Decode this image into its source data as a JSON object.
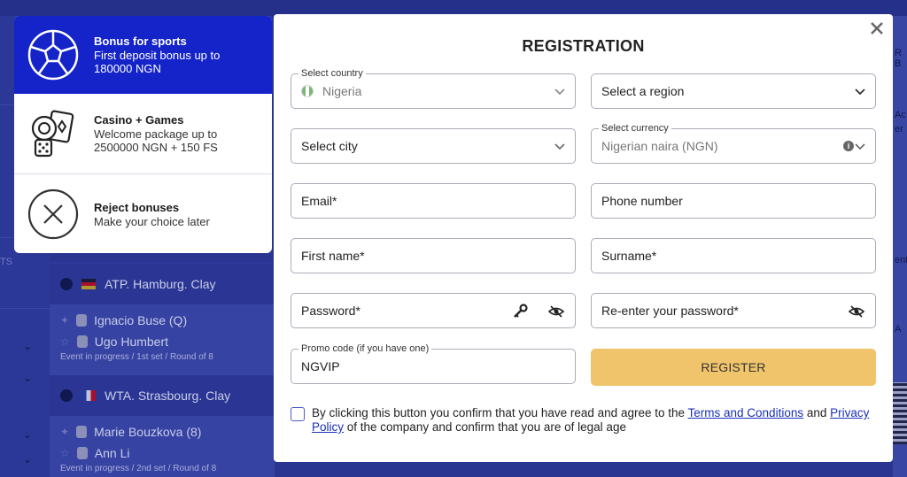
{
  "background": {
    "sports_label": "TS",
    "leagues": [
      {
        "name": "ATP. Hamburg. Clay",
        "players": [
          "Ignacio Buse (Q)",
          "Ugo Humbert"
        ],
        "meta": "Event in progress / 1st set / Round of 8"
      },
      {
        "name": "WTA. Strasbourg. Clay",
        "players": [
          "Marie Bouzkova (8)",
          "Ann Li"
        ],
        "meta": "Event in progress / 2nd set / Round of 8"
      }
    ],
    "right_fragments": [
      "R B",
      "Ac",
      "er",
      "ent",
      "A"
    ]
  },
  "bonuses": [
    {
      "icon": "soccer-ball-icon",
      "title": "Bonus for sports",
      "desc_line1": "First deposit bonus up to",
      "desc_line2": "180000 NGN",
      "active": true
    },
    {
      "icon": "casino-chips-dice-icon",
      "title": "Casino + Games",
      "desc_line1": "Welcome package up to",
      "desc_line2": "2500000 NGN + 150 FS",
      "active": false
    },
    {
      "icon": "reject-x-icon",
      "title": "Reject bonuses",
      "desc_line1": "Make your choice later",
      "desc_line2": "",
      "active": false
    }
  ],
  "modal": {
    "title": "REGISTRATION",
    "country": {
      "legend": "Select country",
      "value": "Nigeria"
    },
    "region": {
      "placeholder": "Select a region"
    },
    "city": {
      "placeholder": "Select city"
    },
    "currency": {
      "legend": "Select currency",
      "value": "Nigerian naira (NGN)"
    },
    "email": {
      "placeholder": "Email*"
    },
    "phone": {
      "placeholder": "Phone number"
    },
    "first_name": {
      "placeholder": "First name*"
    },
    "surname": {
      "placeholder": "Surname*"
    },
    "password": {
      "placeholder": "Password*"
    },
    "password_confirm": {
      "placeholder": "Re-enter your password*"
    },
    "promo": {
      "legend": "Promo code (if you have one)",
      "value": "NGVIP"
    },
    "register_label": "REGISTER",
    "agree": {
      "text_before": "By clicking this button you confirm that you have read and agree to the ",
      "terms_link": "Terms and Conditions",
      "and": " and ",
      "privacy_link": "Privacy Policy",
      "text_after": " of the company and confirm that you are of legal age"
    }
  },
  "colors": {
    "accent": "#1524c9",
    "register_button": "#f0c46b",
    "link": "#1a2fb8"
  }
}
